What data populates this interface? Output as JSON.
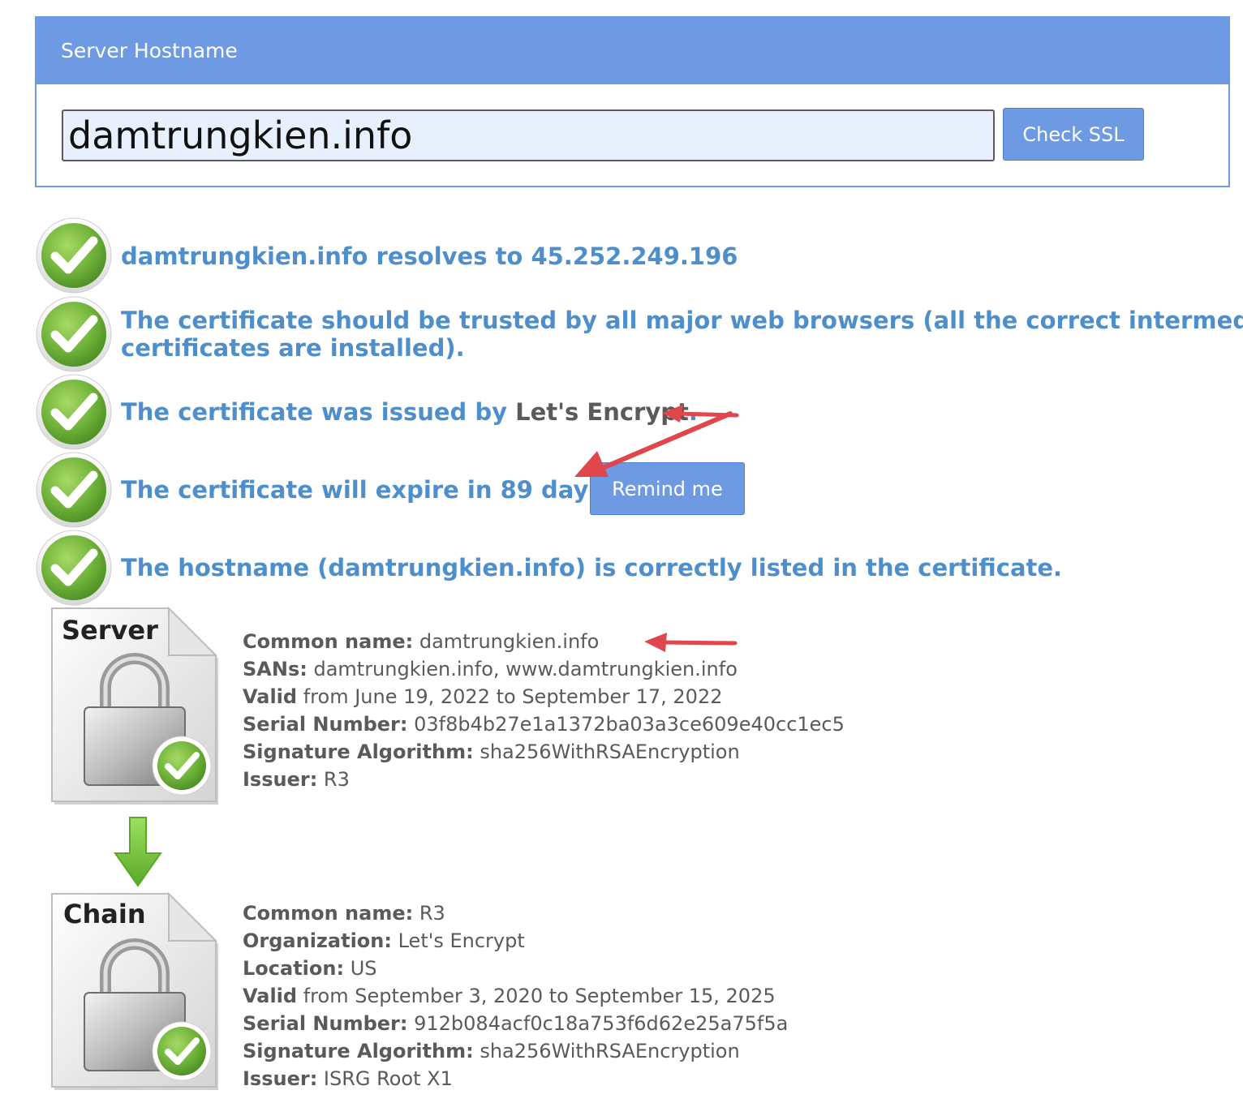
{
  "panel": {
    "title": "Server Hostname",
    "hostname_value": "damtrungkien.info",
    "check_button": "Check SSL"
  },
  "results": {
    "resolves": "damtrungkien.info resolves to 45.252.249.196",
    "trusted_line1": "The certificate should be trusted by all major web browsers (all the correct intermediate",
    "trusted_line2": "certificates are installed).",
    "issued_prefix": "The certificate was issued by ",
    "issued_by": "Let's Encrypt",
    "issued_suffix": ".",
    "expire": "The certificate will expire in 89 days.",
    "remind_button": "Remind me",
    "hostname_listed": "The hostname (damtrungkien.info) is correctly listed in the certificate."
  },
  "server_cert": {
    "icon_label": "Server",
    "common_name_label": "Common name:",
    "common_name": " damtrungkien.info",
    "sans_label": "SANs:",
    "sans": " damtrungkien.info, www.damtrungkien.info",
    "valid_label": "Valid",
    "valid": " from June 19, 2022 to September 17, 2022",
    "serial_label": "Serial Number:",
    "serial": " 03f8b4b27e1a1372ba03a3ce609e40cc1ec5",
    "sigalg_label": "Signature Algorithm:",
    "sigalg": " sha256WithRSAEncryption",
    "issuer_label": "Issuer:",
    "issuer": " R3"
  },
  "chain_cert": {
    "icon_label": "Chain",
    "common_name_label": "Common name:",
    "common_name": " R3",
    "org_label": "Organization:",
    "org": " Let's Encrypt",
    "location_label": "Location:",
    "location": " US",
    "valid_label": "Valid",
    "valid": " from September 3, 2020 to September 15, 2025",
    "serial_label": "Serial Number:",
    "serial": " 912b084acf0c18a753f6d62e25a75f5a",
    "sigalg_label": "Signature Algorithm:",
    "sigalg": " sha256WithRSAEncryption",
    "issuer_label": "Issuer:",
    "issuer": " ISRG Root X1"
  },
  "colors": {
    "accent": "#6d9ae3",
    "link_text": "#4e8fcb",
    "body_text": "#5a5a5a",
    "check_green": "#7cc242",
    "annotation_red": "#e0474c"
  },
  "icons": [
    "check-circle-icon",
    "server-certificate-icon",
    "chain-certificate-icon",
    "down-arrow-icon",
    "annotation-arrow-icon"
  ]
}
